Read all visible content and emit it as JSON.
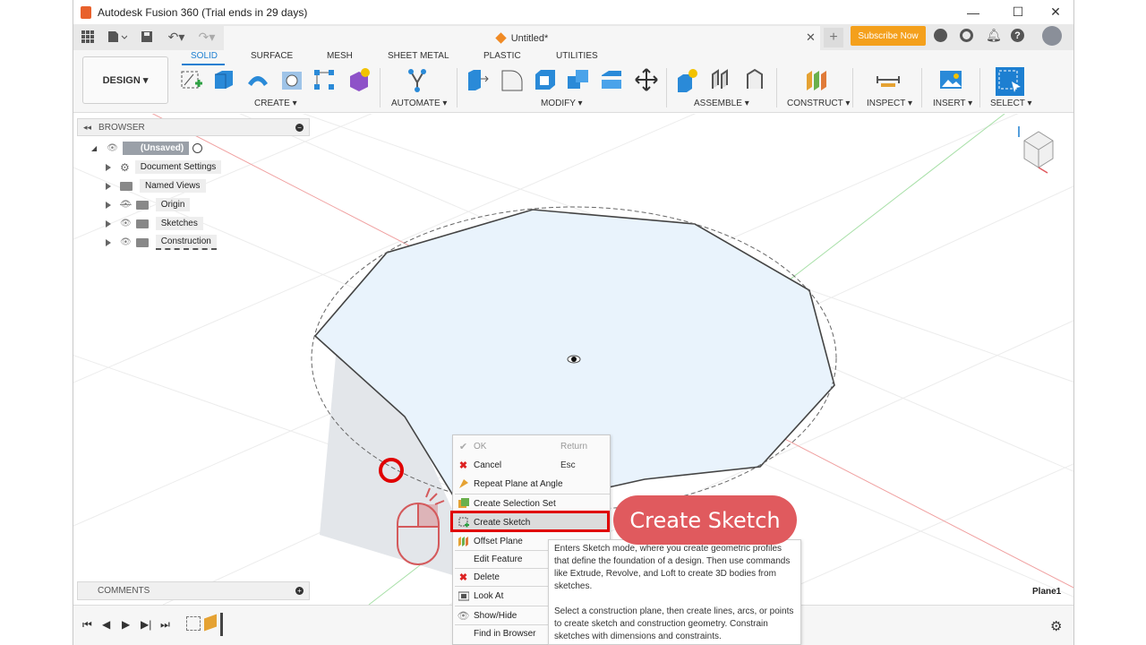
{
  "window": {
    "title": "Autodesk Fusion 360 (Trial ends in 29 days)",
    "controls": [
      "—",
      "☐",
      "✕"
    ]
  },
  "doc_tab": {
    "title": "Untitled*"
  },
  "qat": {
    "subscribe_label": "Subscribe Now"
  },
  "workspace": {
    "label": "DESIGN ▾"
  },
  "tabs": [
    "SOLID",
    "SURFACE",
    "MESH",
    "SHEET METAL",
    "PLASTIC",
    "UTILITIES"
  ],
  "groups": [
    "CREATE ▾",
    "AUTOMATE ▾",
    "MODIFY ▾",
    "ASSEMBLE ▾",
    "CONSTRUCT ▾",
    "INSPECT ▾",
    "INSERT ▾",
    "SELECT ▾"
  ],
  "browser": {
    "header": "BROWSER",
    "items": [
      {
        "label": "(Unsaved)"
      },
      {
        "label": "Document Settings"
      },
      {
        "label": "Named Views"
      },
      {
        "label": "Origin"
      },
      {
        "label": "Sketches"
      },
      {
        "label": "Construction"
      }
    ]
  },
  "comments": {
    "header": "COMMENTS"
  },
  "viewport": {
    "plane_label": "Plane1"
  },
  "context_menu": {
    "items": [
      {
        "label": "OK",
        "shortcut": "Return",
        "icon": "check-icon",
        "disabled": true
      },
      {
        "label": "Cancel",
        "shortcut": "Esc",
        "icon": "x-icon"
      },
      {
        "label": "Repeat Plane at Angle",
        "shortcut": "",
        "icon": "plane-angle-icon"
      },
      {
        "label": "Create Selection Set",
        "shortcut": "",
        "icon": "selection-set-icon"
      },
      {
        "label": "Create Sketch",
        "shortcut": "",
        "icon": "sketch-icon",
        "highlighted": true
      },
      {
        "label": "Offset Plane",
        "shortcut": "",
        "icon": "offset-plane-icon"
      },
      {
        "label": "Edit Feature",
        "shortcut": "",
        "icon": ""
      },
      {
        "label": "Delete",
        "shortcut": "",
        "icon": "x-icon"
      },
      {
        "label": "Look At",
        "shortcut": "",
        "icon": "look-at-icon"
      },
      {
        "label": "Show/Hide",
        "shortcut": "",
        "icon": "eye-icon"
      },
      {
        "label": "Find in Browser",
        "shortcut": "",
        "icon": ""
      }
    ]
  },
  "tooltip": {
    "para1": "Enters Sketch mode, where you create geometric profiles that define the foundation of a design. Then use commands like Extrude, Revolve, and Loft to create 3D bodies from sketches.",
    "para2": "Select a construction plane, then create lines, arcs, or points to create sketch and construction geometry. Constrain sketches with dimensions and constraints."
  },
  "callout": {
    "label": "Create Sketch"
  },
  "colors": {
    "accent": "#1d7fd1",
    "callout": "#e05a5e",
    "highlight": "#e00000",
    "subscribe": "#f4a01c"
  }
}
